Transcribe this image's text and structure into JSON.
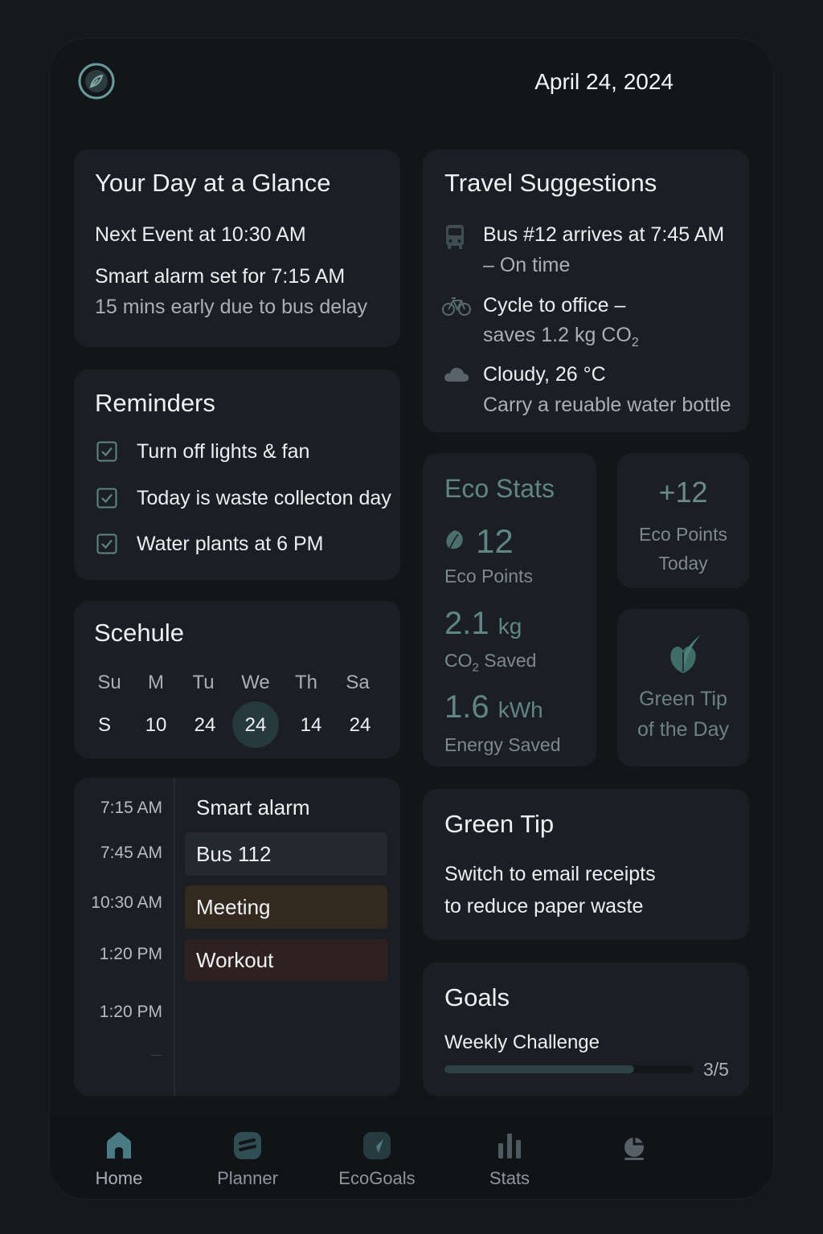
{
  "header": {
    "date": "April 24, 2024"
  },
  "glance": {
    "title": "Your Day at a Glance",
    "next_event": "Next Event at 10:30 AM",
    "alarm": "Smart alarm set for 7:15 AM",
    "alarm_note": "15 mins early due to bus delay"
  },
  "reminders": {
    "title": "Reminders",
    "items": [
      {
        "label": "Turn off lights & fan",
        "checked": true
      },
      {
        "label": "Today is waste collecton day",
        "checked": true
      },
      {
        "label": "Water plants at 6 PM",
        "checked": true
      }
    ]
  },
  "schedule": {
    "title": "Scehule",
    "days": [
      "Su",
      "M",
      "Tu",
      "We",
      "Th",
      "Sa"
    ],
    "dates": [
      "S",
      "10",
      "24",
      "24",
      "14",
      "24"
    ],
    "selected_index": 3
  },
  "timeline": {
    "times": [
      "7:15 AM",
      "7:45 AM",
      "10:30 AM",
      "1:20 PM",
      "1:20 PM",
      "—"
    ],
    "events": [
      {
        "label": "Smart alarm",
        "color": "transparent"
      },
      {
        "label": "Bus 112",
        "color": "#23292e"
      },
      {
        "label": "Meeting",
        "color": "#33291f"
      },
      {
        "label": "Workout",
        "color": "#2f2021"
      }
    ]
  },
  "travel": {
    "title": "Travel Suggestions",
    "items": [
      {
        "icon": "bus-icon",
        "line1": "Bus #12 arrives at 7:45 AM",
        "line2": "– On time"
      },
      {
        "icon": "bicycle-icon",
        "line1": "Cycle to office –",
        "line2": "saves 1.2 kg CO",
        "line2_sub": "2"
      },
      {
        "icon": "cloud-icon",
        "line1": "Cloudy, 26 °C",
        "line2": "Carry a reuable water bottle"
      }
    ]
  },
  "eco_stats": {
    "title": "Eco Stats",
    "points_value": "12",
    "points_label": "Eco Points",
    "co2_value": "2.1",
    "co2_unit": "kg",
    "co2_label_prefix": "CO",
    "co2_label_sub": "2",
    "co2_label_suffix": "Saved",
    "energy_value": "1.6",
    "energy_unit": "kWh",
    "energy_label": "Energy Saved"
  },
  "eco_today": {
    "value": "+12",
    "label_line1": "Eco Points",
    "label_line2": "Today"
  },
  "tip_tile": {
    "line1": "Green Tip",
    "line2": "of the Day"
  },
  "green_tip": {
    "title": "Green Tip",
    "line1": "Switch to email receipts",
    "line2": "to reduce paper waste"
  },
  "goals": {
    "title": "Goals",
    "challenge": "Weekly Challenge",
    "progress_text": "3/5",
    "progress_fraction": 0.76
  },
  "nav": {
    "items": [
      {
        "label": "Home",
        "icon": "home-icon"
      },
      {
        "label": "Planner",
        "icon": "planner-icon"
      },
      {
        "label": "EcoGoals",
        "icon": "ecogoals-icon"
      },
      {
        "label": "Stats",
        "icon": "stats-icon"
      },
      {
        "label": "",
        "icon": "profile-icon"
      }
    ]
  },
  "colors": {
    "accent_teal": "#5f8585",
    "card_bg": "#1b1f23",
    "page_bg": "#16191c"
  }
}
